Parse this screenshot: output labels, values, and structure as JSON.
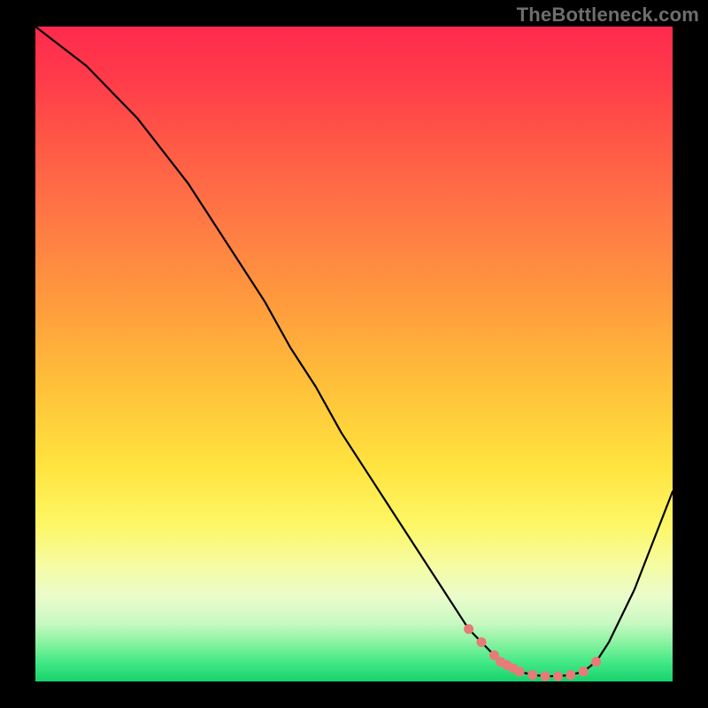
{
  "watermark": "TheBottleneck.com",
  "colors": {
    "background": "#000000",
    "curve_stroke": "#000000",
    "marker_fill": "#e87a78",
    "gradient_top": "#ff2a4d",
    "gradient_bottom": "#16d36d"
  },
  "chart_data": {
    "type": "line",
    "title": "",
    "xlabel": "",
    "ylabel": "",
    "xlim": [
      0,
      100
    ],
    "ylim": [
      0,
      100
    ],
    "grid": false,
    "legend": false,
    "series": [
      {
        "name": "bottleneck-curve",
        "x": [
          0,
          4,
          8,
          12,
          16,
          20,
          24,
          28,
          32,
          36,
          40,
          44,
          48,
          52,
          56,
          60,
          64,
          68,
          70,
          72,
          74,
          76,
          78,
          80,
          82,
          84,
          86,
          88,
          90,
          92,
          94,
          96,
          98,
          100
        ],
        "y": [
          100,
          97,
          94,
          90,
          86,
          81,
          76,
          70,
          64,
          58,
          51,
          45,
          38,
          32,
          26,
          20,
          14,
          8,
          6,
          4,
          2.5,
          1.5,
          1,
          0.8,
          0.8,
          1,
          1.5,
          3,
          6,
          10,
          14,
          19,
          24,
          29
        ]
      }
    ],
    "markers": {
      "name": "valley-markers",
      "x": [
        68,
        70,
        72,
        73,
        74,
        75,
        76,
        78,
        80,
        82,
        84,
        86,
        88
      ],
      "y": [
        8,
        6,
        4,
        3,
        2.5,
        2,
        1.5,
        1,
        0.8,
        0.8,
        1,
        1.5,
        3
      ]
    }
  }
}
